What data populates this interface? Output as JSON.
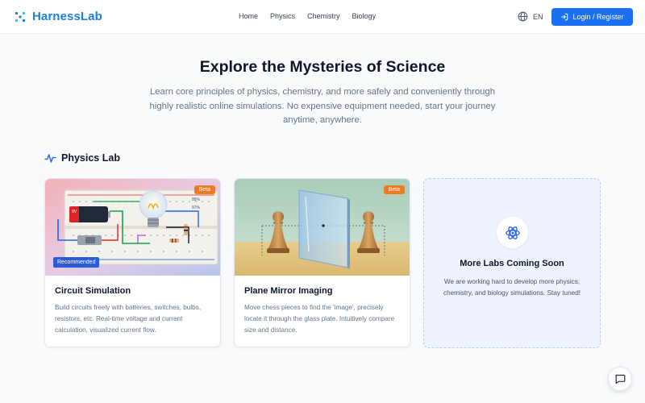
{
  "brand": {
    "name": "HarnessLab",
    "icon": "sparkle-logo-icon",
    "color": "#1d7fe0"
  },
  "nav": {
    "items": [
      "Home",
      "Physics",
      "Chemistry",
      "Biology"
    ]
  },
  "lang": {
    "label": "EN",
    "icon": "globe-icon"
  },
  "login": {
    "label": "Login / Register",
    "icon": "login-arrow-icon",
    "color": "#1d6ff2"
  },
  "hero": {
    "title": "Explore the Mysteries of Science",
    "subtitle": "Learn core principles of physics, chemistry, and more safely and conveniently through highly realistic online simulations. No expensive equipment needed, start your journey anytime, anywhere."
  },
  "section": {
    "title": "Physics Lab",
    "icon": "pulse-icon"
  },
  "cards": [
    {
      "title": "Circuit Simulation",
      "description": "Build circuits freely with batteries, switches, bulbs, resistors, etc. Real-time voltage and current calculation, visualized current flow.",
      "badge": "Beta",
      "tag": "Recommended",
      "image_labels": {
        "battery": "9V",
        "reading1": "85%",
        "reading2": "87%"
      }
    },
    {
      "title": "Plane Mirror Imaging",
      "description": "Move chess pieces to find the 'image', precisely locate it through the glass plate. Intuitively compare size and distance.",
      "badge": "Beta"
    }
  ],
  "coming_soon": {
    "title": "More Labs Coming Soon",
    "description": "We are working hard to develop more physics, chemistry, and biology simulations. Stay tuned!",
    "icon": "atom-icon"
  },
  "chat": {
    "icon": "chat-bubble-icon"
  },
  "colors": {
    "accent": "#1d6ff2",
    "beta": "#f07a1f",
    "recommended": "#2c5bd6"
  }
}
